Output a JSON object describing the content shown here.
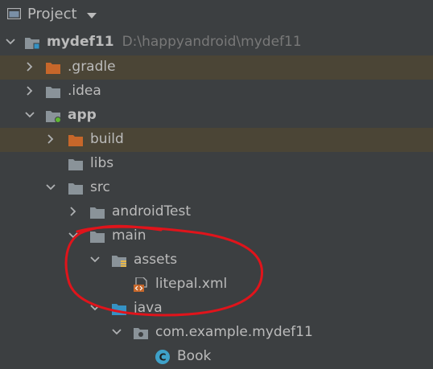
{
  "header": {
    "title": "Project"
  },
  "tree": {
    "root": {
      "name": "mydef11",
      "path": "D:\\happyandroid\\mydef11"
    },
    "gradle": {
      "name": ".gradle"
    },
    "idea": {
      "name": ".idea"
    },
    "app": {
      "name": "app"
    },
    "build": {
      "name": "build"
    },
    "libs": {
      "name": "libs"
    },
    "src": {
      "name": "src"
    },
    "androidTest": {
      "name": "androidTest"
    },
    "main": {
      "name": "main"
    },
    "assets": {
      "name": "assets"
    },
    "litepal": {
      "name": "litepal.xml"
    },
    "java": {
      "name": "java"
    },
    "pkg": {
      "name": "com.example.mydef11"
    },
    "book": {
      "name": "Book"
    }
  },
  "colors": {
    "background": "#3c3f41",
    "text": "#bbbbbb",
    "folder": "#8a9399",
    "excluded_folder": "#c7672a",
    "excluded_row": "#4b4536",
    "source_folder": "#3592c4",
    "class_icon": "#3ea1c9",
    "annotation": "#e0141b"
  },
  "icons": {
    "project": "window-icon",
    "folder": "folder-icon",
    "module": "module-folder-icon",
    "resource": "resource-folder-icon",
    "xml": "xml-file-icon",
    "package": "package-icon",
    "class": "class-icon"
  }
}
